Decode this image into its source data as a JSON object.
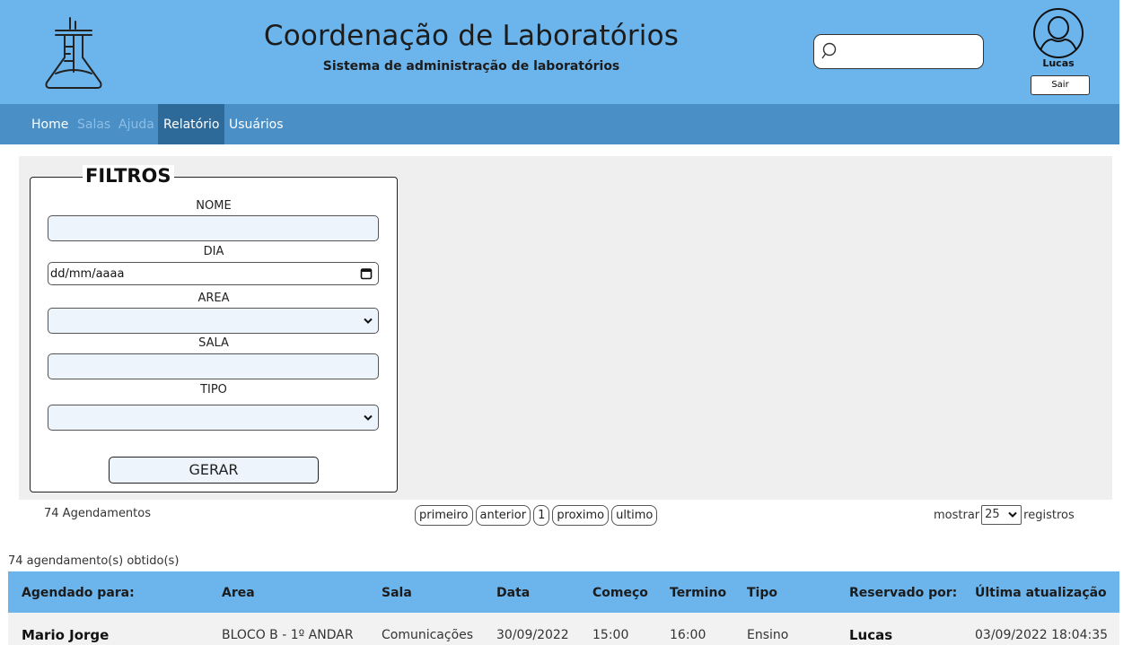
{
  "header": {
    "title": "Coordenação de Laboratórios",
    "subtitle": "Sistema de administração de laboratórios",
    "logo_icon": "lab-flask-icon",
    "search": {
      "value": "",
      "placeholder": ""
    },
    "user": {
      "name": "Lucas",
      "logout_label": "Sair",
      "avatar_icon": "user-avatar-icon"
    }
  },
  "nav": {
    "items": [
      {
        "label": "Home",
        "state": "normal"
      },
      {
        "label": "Salas",
        "state": "muted"
      },
      {
        "label": "Ajuda",
        "state": "muted"
      },
      {
        "label": "Relatório",
        "state": "active"
      },
      {
        "label": "Usuários",
        "state": "normal"
      }
    ]
  },
  "filters": {
    "legend": "FILTROS",
    "nome_label": "NOME",
    "nome_value": "",
    "dia_label": "DIA",
    "dia_value": "dd/mm/aaaa",
    "area_label": "AREA",
    "area_value": "",
    "sala_label": "SALA",
    "sala_value": "",
    "tipo_label": "TIPO",
    "tipo_value": "",
    "generate_label": "GERAR"
  },
  "pagination": {
    "count_label": "74 Agendamentos",
    "first_label": "primeiro",
    "prev_label": "anterior",
    "page_label": "1",
    "next_label": "proximo",
    "last_label": "ultimo",
    "show_prefix": "mostrar",
    "show_value": "25",
    "show_suffix": "registros"
  },
  "results": {
    "summary": "74 agendamento(s) obtido(s)",
    "columns": [
      "Agendado para:",
      "Area",
      "Sala",
      "Data",
      "Começo",
      "Termino",
      "Tipo",
      "Reservado por:",
      "Última atualização"
    ],
    "rows": [
      [
        "Mario Jorge",
        "BLOCO B - 1º ANDAR",
        "Comunicações",
        "30/09/2022",
        "15:00",
        "16:00",
        "Ensino",
        "Lucas",
        "03/09/2022 18:04:35"
      ]
    ]
  },
  "colors": {
    "header_bg": "#6cb4ec",
    "nav_bg": "#4a8fc5",
    "nav_active_bg": "#2e6a99",
    "table_header_bg": "#6cb4ec"
  }
}
